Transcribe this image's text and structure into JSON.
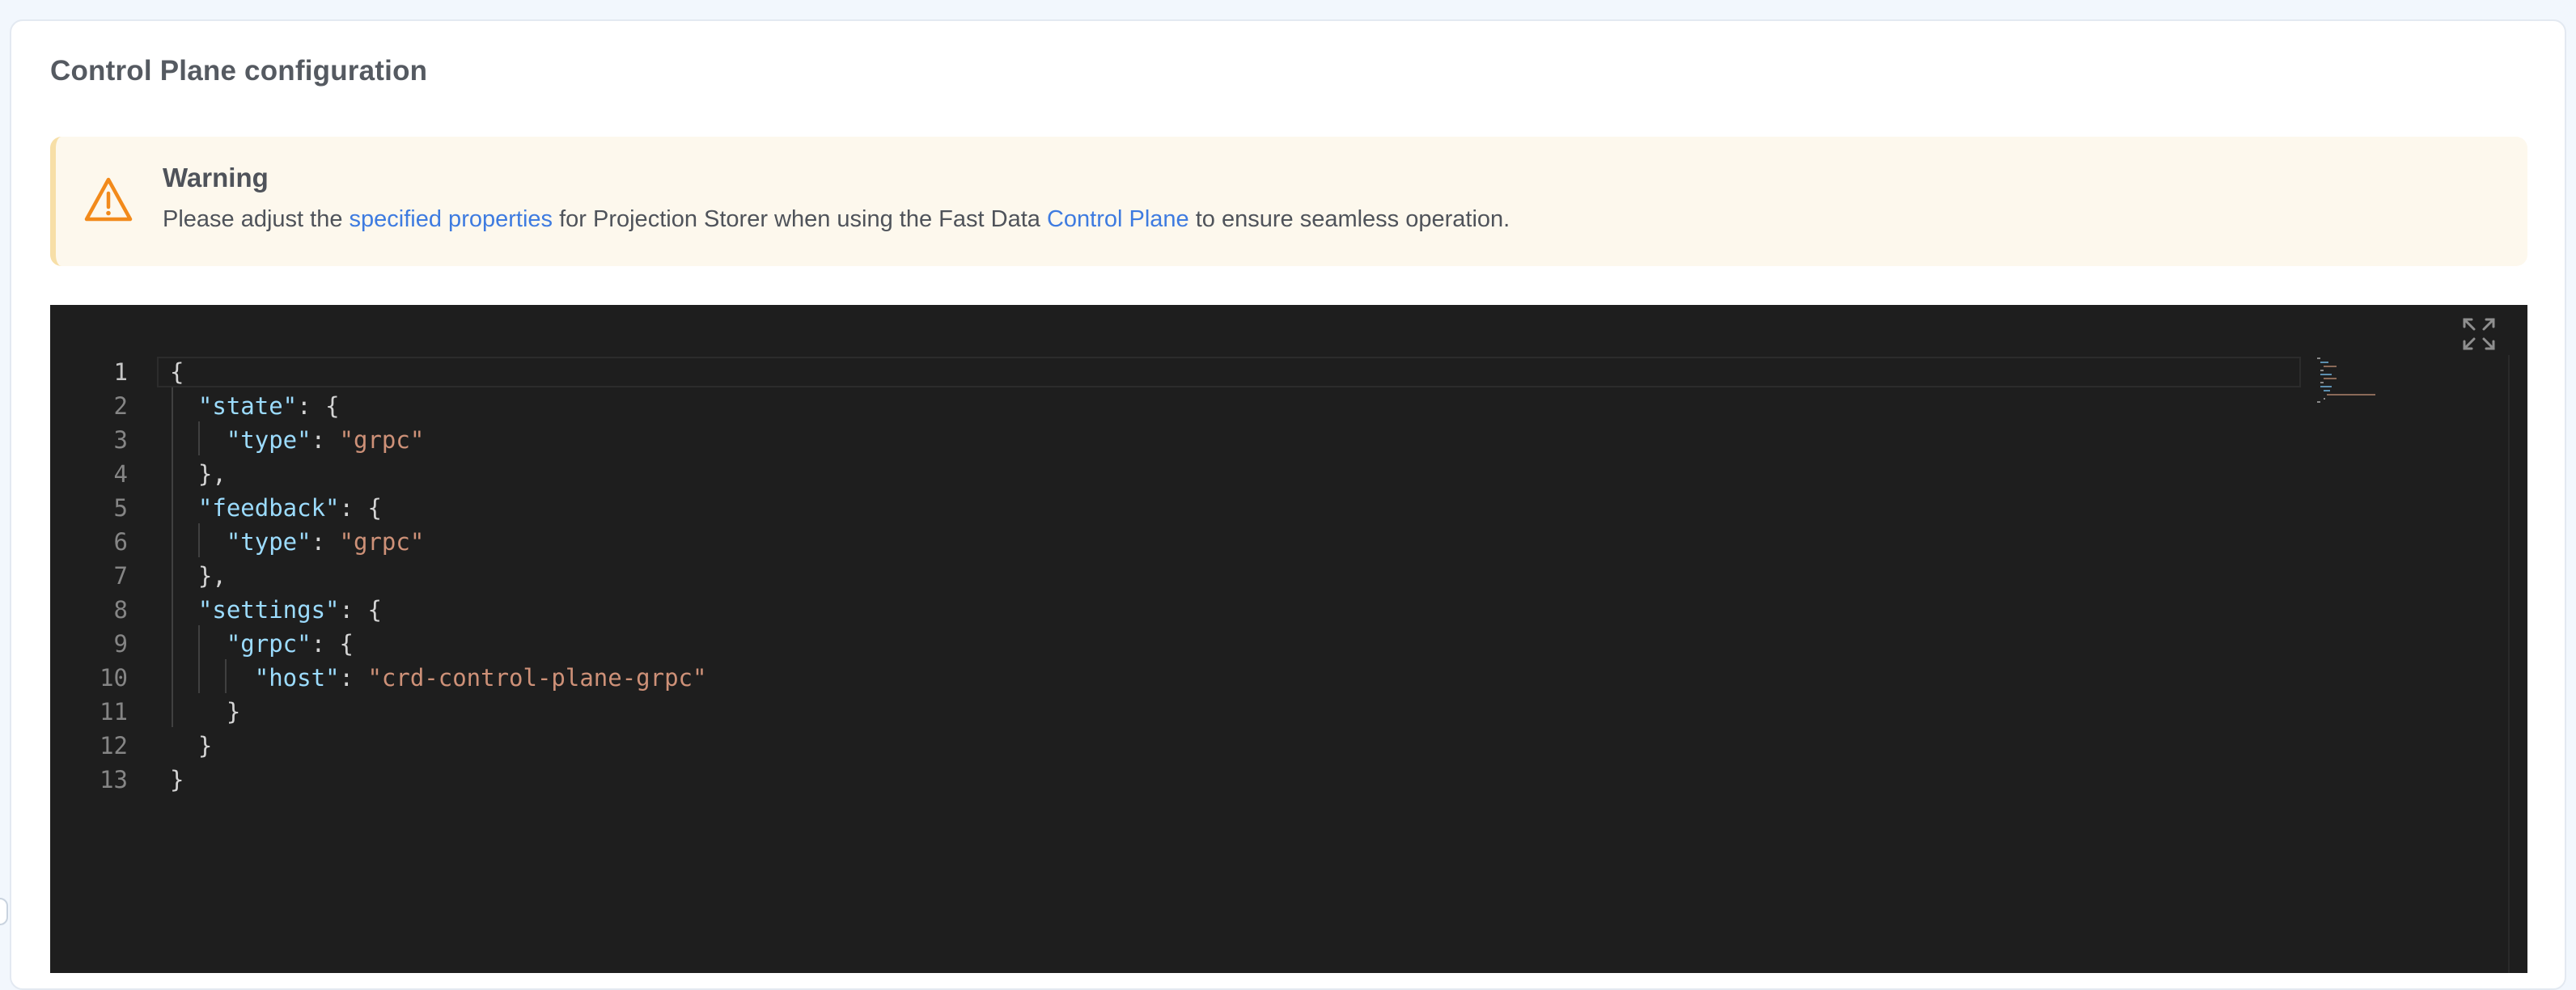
{
  "section": {
    "title": "Control Plane configuration"
  },
  "warning": {
    "title": "Warning",
    "text_1": "Please adjust the ",
    "link_1": "specified properties",
    "text_2": " for Projection Storer when using the Fast Data ",
    "link_2": "Control Plane",
    "text_3": " to ensure seamless operation.",
    "icon": "warning-triangle-icon",
    "accent_color": "#f28a1b"
  },
  "editor": {
    "expand_icon": "expand-icon",
    "background": "#1e1e1e",
    "lines": [
      {
        "num": "1",
        "indent": "",
        "key": "",
        "sep": "",
        "value": "",
        "tail": "{"
      },
      {
        "num": "2",
        "indent": "  ",
        "key": "\"state\"",
        "sep": ": ",
        "value": "",
        "tail": "{"
      },
      {
        "num": "3",
        "indent": "    ",
        "key": "\"type\"",
        "sep": ": ",
        "value": "\"grpc\"",
        "tail": ""
      },
      {
        "num": "4",
        "indent": "  ",
        "key": "",
        "sep": "",
        "value": "",
        "tail": "},"
      },
      {
        "num": "5",
        "indent": "  ",
        "key": "\"feedback\"",
        "sep": ": ",
        "value": "",
        "tail": "{"
      },
      {
        "num": "6",
        "indent": "    ",
        "key": "\"type\"",
        "sep": ": ",
        "value": "\"grpc\"",
        "tail": ""
      },
      {
        "num": "7",
        "indent": "  ",
        "key": "",
        "sep": "",
        "value": "",
        "tail": "},"
      },
      {
        "num": "8",
        "indent": "  ",
        "key": "\"settings\"",
        "sep": ": ",
        "value": "",
        "tail": "{"
      },
      {
        "num": "9",
        "indent": "    ",
        "key": "\"grpc\"",
        "sep": ": ",
        "value": "",
        "tail": "{"
      },
      {
        "num": "10",
        "indent": "      ",
        "key": "\"host\"",
        "sep": ": ",
        "value": "\"crd-control-plane-grpc\"",
        "tail": ""
      },
      {
        "num": "11",
        "indent": "    ",
        "key": "",
        "sep": "",
        "value": "",
        "tail": "}"
      },
      {
        "num": "12",
        "indent": "  ",
        "key": "",
        "sep": "",
        "value": "",
        "tail": "}"
      },
      {
        "num": "13",
        "indent": "",
        "key": "",
        "sep": "",
        "value": "",
        "tail": "}"
      }
    ]
  }
}
